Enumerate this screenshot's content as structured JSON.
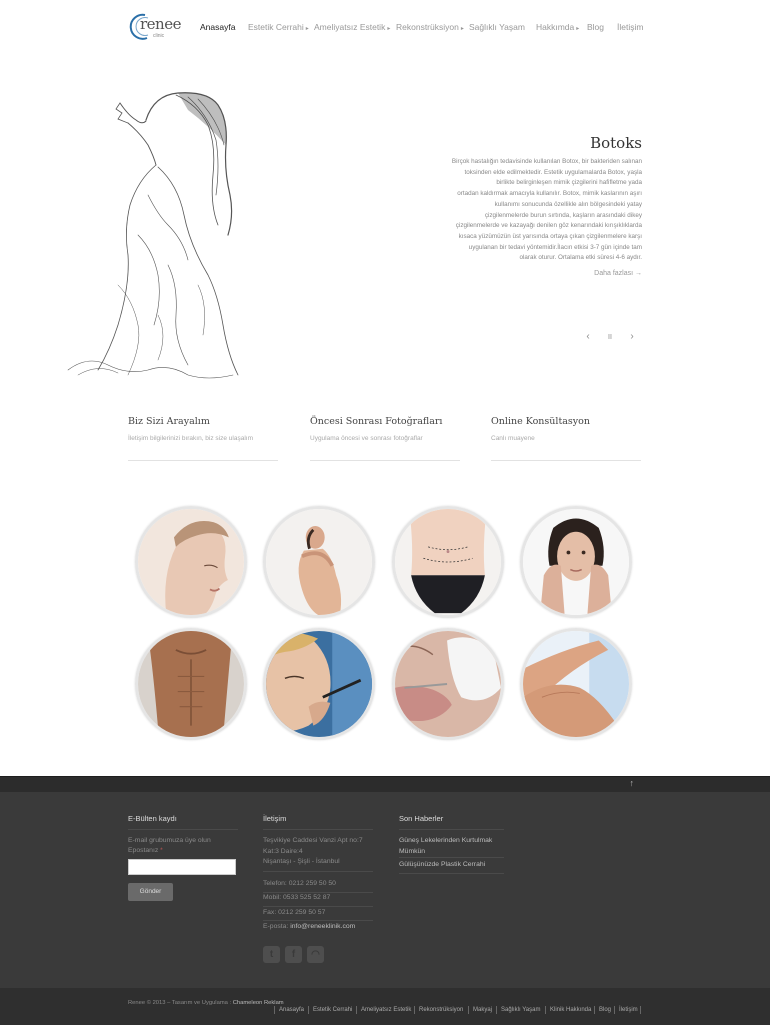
{
  "brand": {
    "name": "renee",
    "sub": "clinic"
  },
  "nav": [
    {
      "label": "Anasayfa",
      "active": true,
      "dropdown": false
    },
    {
      "label": "Estetik Cerrahi",
      "dropdown": true
    },
    {
      "label": "Ameliyatsız Estetik",
      "dropdown": true
    },
    {
      "label": "Rekonstrüksiyon",
      "dropdown": true
    },
    {
      "label": "Sağlıklı Yaşam",
      "dropdown": false
    },
    {
      "label": "Hakkımda",
      "dropdown": true
    },
    {
      "label": "Blog",
      "dropdown": false
    },
    {
      "label": "İletişim",
      "dropdown": false
    }
  ],
  "hero": {
    "title": "Botoks",
    "lines": [
      "Birçok hastalığın tedavisinde kullanılan Botox, bir bakteriden salınan",
      "toksinden elde edilmektedir. Estetik uygulamalarda Botox, yaşla",
      "birlikte belirginleşen mimik çizgilerini hafifletme yada",
      "ortadan kaldırmak amacıyla kullanılır. Botox, mimik kaslarının aşırı",
      "kullanımı sonucunda özellikle alın bölgesindeki yatay",
      "çizgilenmelerde burun sırtında, kaşların arasındaki dikey",
      "çizgilenmelerde ve kazayağı denilen göz kenarındaki kırışıklıklarda",
      "kısaca yüzümüzün üst yarısında ortaya çıkan çizgilenmelere karşı",
      "uygulanan bir tedavi yöntemidir.İlacın etkisi 3-7 gün içinde tam",
      "olarak oturur. Ortalama etki süresi 4-6 aydır."
    ],
    "more": "Daha fazlası →",
    "prev": "‹",
    "pause": "II",
    "next": "›"
  },
  "features": [
    {
      "title": "Biz Sizi Arayalım",
      "desc": "İletişim bilgilerinizi bırakın, biz size ulaşalım"
    },
    {
      "title": "Öncesi Sonrası Fotoğrafları",
      "desc": "Uygulama öncesi ve sonrası fotoğraflar"
    },
    {
      "title": "Online Konsültasyon",
      "desc": "Canlı muayene"
    }
  ],
  "footer": {
    "up": "↑",
    "newsletter": {
      "title": "E-Bülten kaydı",
      "desc": "E-mail grubumuza üye olun",
      "label": "Epostanız",
      "required": "*",
      "button": "Gönder"
    },
    "contact": {
      "title": "İletişim",
      "address": [
        "Teşvikiye Caddesi Vanzi Apt no:7",
        "Kat:3 Daire:4",
        "Nişantaşı - Şişli - İstanbul"
      ],
      "phone": "Telefon: 0212 259 50 50",
      "mobile": "Mobil: 0533 525 52 87",
      "fax": "Fax: 0212 259 50 57",
      "email_label": "E-posta:",
      "email": "info@reneeklinik.com"
    },
    "news": {
      "title": "Son Haberler",
      "items": [
        [
          "Güneş Lekelerinden Kurtulmak",
          "Mümkün"
        ],
        [
          "Gülüşünüzde Plastik Cerrahi"
        ]
      ]
    },
    "social": [
      {
        "icon": "twitter-icon",
        "glyph": "t"
      },
      {
        "icon": "facebook-icon",
        "glyph": "f"
      },
      {
        "icon": "rss-icon",
        "glyph": "◠"
      }
    ],
    "copyright": "Renee © 2013 – Tasarım ve Uygulama :",
    "agency": "Chameleon Reklam",
    "bottom_nav": [
      "Anasayfa",
      "Estetik Cerrahi",
      "Ameliyatsız Estetik",
      "Rekonstrüksiyon",
      "Makyaj",
      "Sağlıklı Yaşam",
      "Klinik Hakkında",
      "Blog",
      "İletişim"
    ]
  }
}
